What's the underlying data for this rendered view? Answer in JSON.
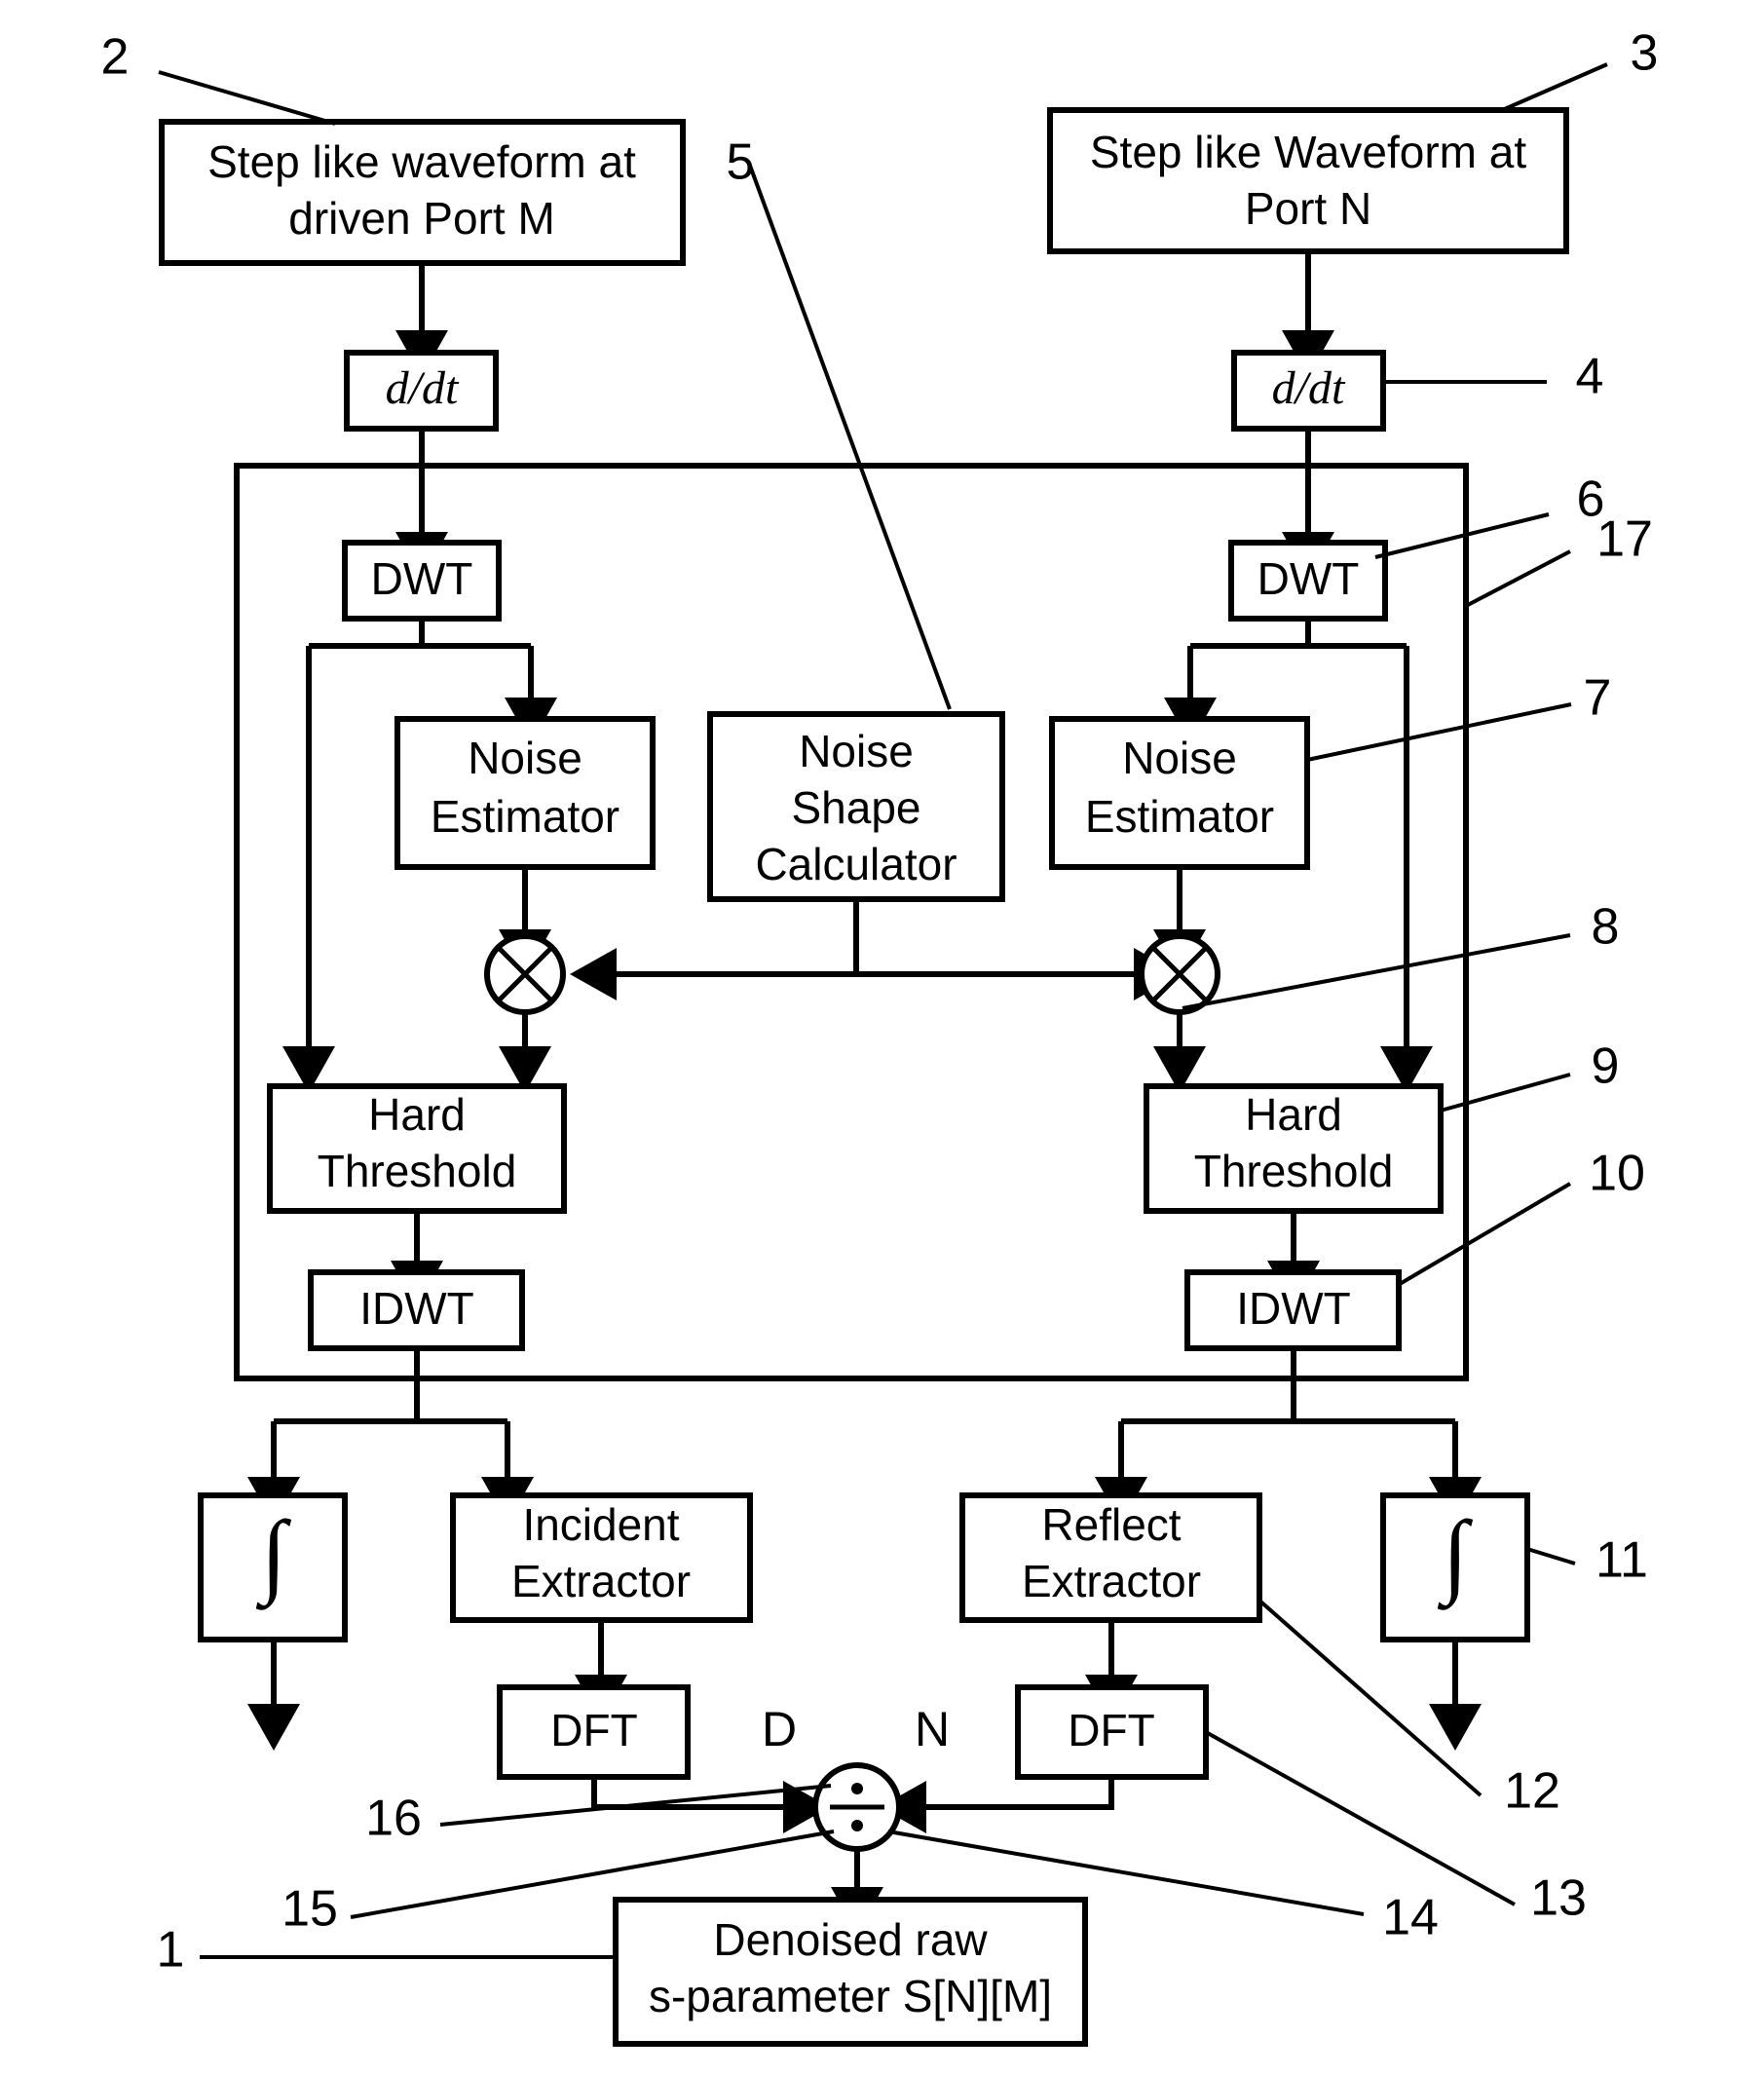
{
  "diagram": {
    "title": "Denoising signal-flow block diagram for raw s-parameter extraction",
    "background_color": "#ffffff",
    "line_color": "#000000"
  },
  "blocks": {
    "step_m": {
      "line1": "Step like waveform at",
      "line2": "driven Port M"
    },
    "step_n": {
      "line1": "Step like Waveform at",
      "line2": "Port N"
    },
    "ddt_left": {
      "label": "d/dt"
    },
    "ddt_right": {
      "label": "d/dt"
    },
    "dwt_left": {
      "label": "DWT"
    },
    "dwt_right": {
      "label": "DWT"
    },
    "noise_est_left": {
      "line1": "Noise",
      "line2": "Estimator"
    },
    "noise_est_right": {
      "line1": "Noise",
      "line2": "Estimator"
    },
    "noise_shape": {
      "line1": "Noise",
      "line2": "Shape",
      "line3": "Calculator"
    },
    "hard_thresh_left": {
      "line1": "Hard",
      "line2": "Threshold"
    },
    "hard_thresh_right": {
      "line1": "Hard",
      "line2": "Threshold"
    },
    "idwt_left": {
      "label": "IDWT"
    },
    "idwt_right": {
      "label": "IDWT"
    },
    "integrator_left": {
      "label": "∫"
    },
    "integrator_right": {
      "label": "∫"
    },
    "incident_extractor": {
      "line1": "Incident",
      "line2": "Extractor"
    },
    "reflect_extractor": {
      "line1": "Reflect",
      "line2": "Extractor"
    },
    "dft_left": {
      "label": "DFT"
    },
    "dft_right": {
      "label": "DFT"
    },
    "output": {
      "line1": "Denoised raw",
      "line2": "s-parameter S[N][M]"
    }
  },
  "operators": {
    "multiply_left": {
      "symbol": "⊗"
    },
    "multiply_right": {
      "symbol": "⊗"
    },
    "divide": {
      "symbol": "÷",
      "numerator_label": "D",
      "denominator_label": "N"
    }
  },
  "reference_numerals": {
    "n1": "1",
    "n2": "2",
    "n3": "3",
    "n4": "4",
    "n5": "5",
    "n6": "6",
    "n7": "7",
    "n8": "8",
    "n9": "9",
    "n10": "10",
    "n11": "11",
    "n12": "12",
    "n13": "13",
    "n14": "14",
    "n15": "15",
    "n16": "16",
    "n17": "17"
  }
}
